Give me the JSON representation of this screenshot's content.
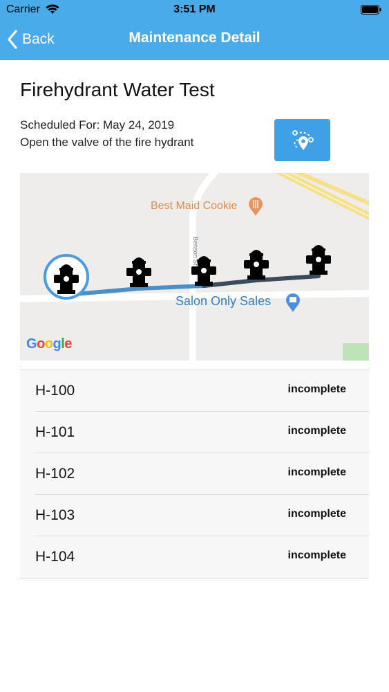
{
  "status_bar": {
    "carrier": "Carrier",
    "time": "3:51 PM"
  },
  "nav": {
    "back_label": "Back",
    "title": "Maintenance Detail"
  },
  "header": {
    "title": "Firehydrant Water Test",
    "scheduled": "Scheduled For: May 24, 2019",
    "description": "Open the valve of the fire hydrant",
    "route_icon": "route-map-icon"
  },
  "map": {
    "poi_cookie": "Best Maid Cookie",
    "poi_sales": "Salon Only Sales",
    "street": "Benson St",
    "provider": "Google",
    "marker_icon": "fire-hydrant-icon"
  },
  "hydrants": [
    {
      "name": "H-100",
      "status": "incomplete"
    },
    {
      "name": "H-101",
      "status": "incomplete"
    },
    {
      "name": "H-102",
      "status": "incomplete"
    },
    {
      "name": "H-103",
      "status": "incomplete"
    },
    {
      "name": "H-104",
      "status": "incomplete"
    }
  ],
  "colors": {
    "nav_bar": "#4AABEA",
    "route_button": "#3FA0E8",
    "route_line": "#4A90C8",
    "accent": "#4285F4"
  }
}
